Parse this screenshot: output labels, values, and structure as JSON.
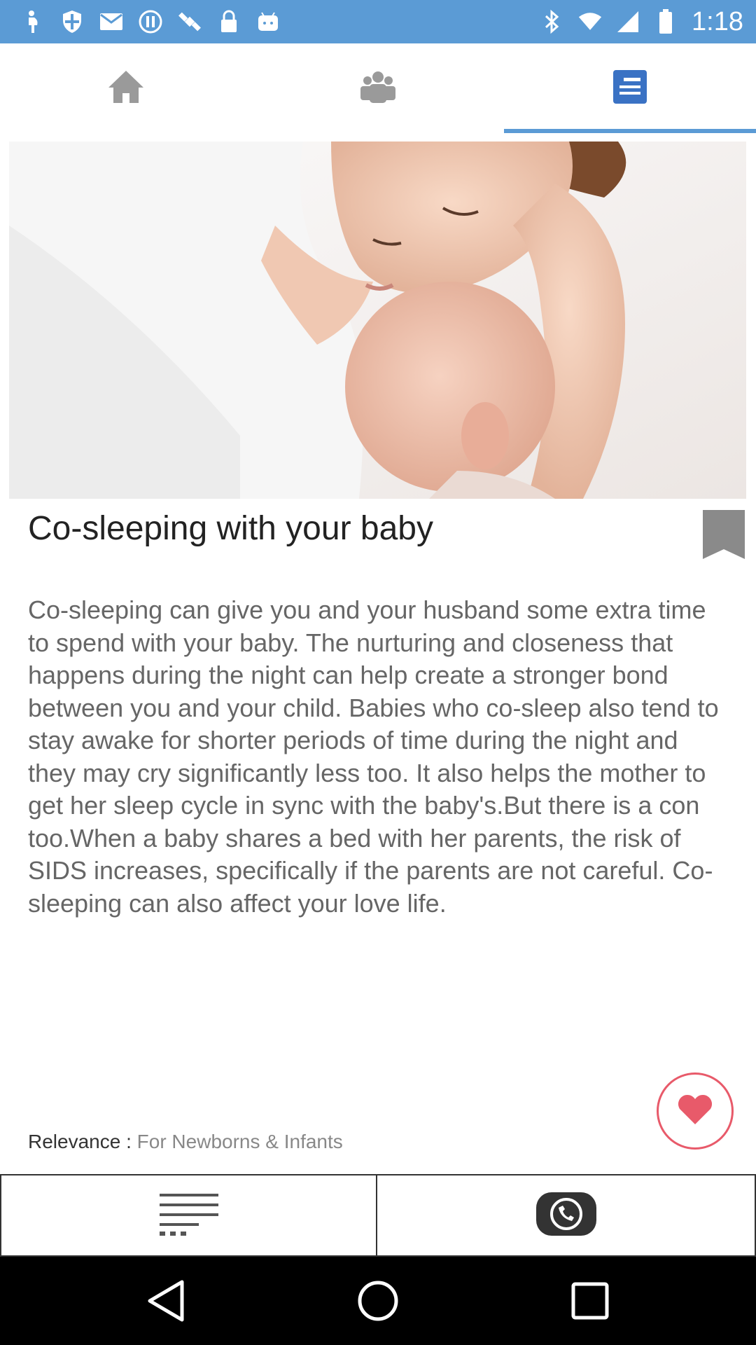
{
  "status_bar": {
    "time": "1:18",
    "icons_left": [
      "pregnancy-icon",
      "shield-icon",
      "mail-icon",
      "info-icon",
      "satellite-icon",
      "lock-icon",
      "android-icon"
    ],
    "icons_right": [
      "bluetooth-icon",
      "wifi-icon",
      "signal-icon",
      "battery-icon"
    ]
  },
  "tabs": [
    {
      "name": "home",
      "icon": "home-icon",
      "active": false
    },
    {
      "name": "community",
      "icon": "people-icon",
      "active": false
    },
    {
      "name": "articles",
      "icon": "article-icon",
      "active": true
    }
  ],
  "article": {
    "title": "Co-sleeping with your baby",
    "body": "Co-sleeping can give you and your husband some extra time to spend with your baby. The nurturing and closeness that happens during the night can help create a stronger bond between you and your child. Babies who co-sleep also tend to stay awake for shorter periods of time during the night and they may cry significantly less too. It also helps the mother to get her sleep cycle in sync with the baby's.But there is a con too.When a baby shares a bed with her parents, the risk of SIDS increases, specifically if the parents are not careful. Co-sleeping can also affect your love life.",
    "relevance_label": "Relevance :",
    "relevance_value": "For Newborns & Infants"
  },
  "actions": {
    "menu": "menu-icon",
    "share": "whatsapp-icon"
  },
  "colors": {
    "accent": "#5b9bd5",
    "like": "#e85a6a"
  }
}
